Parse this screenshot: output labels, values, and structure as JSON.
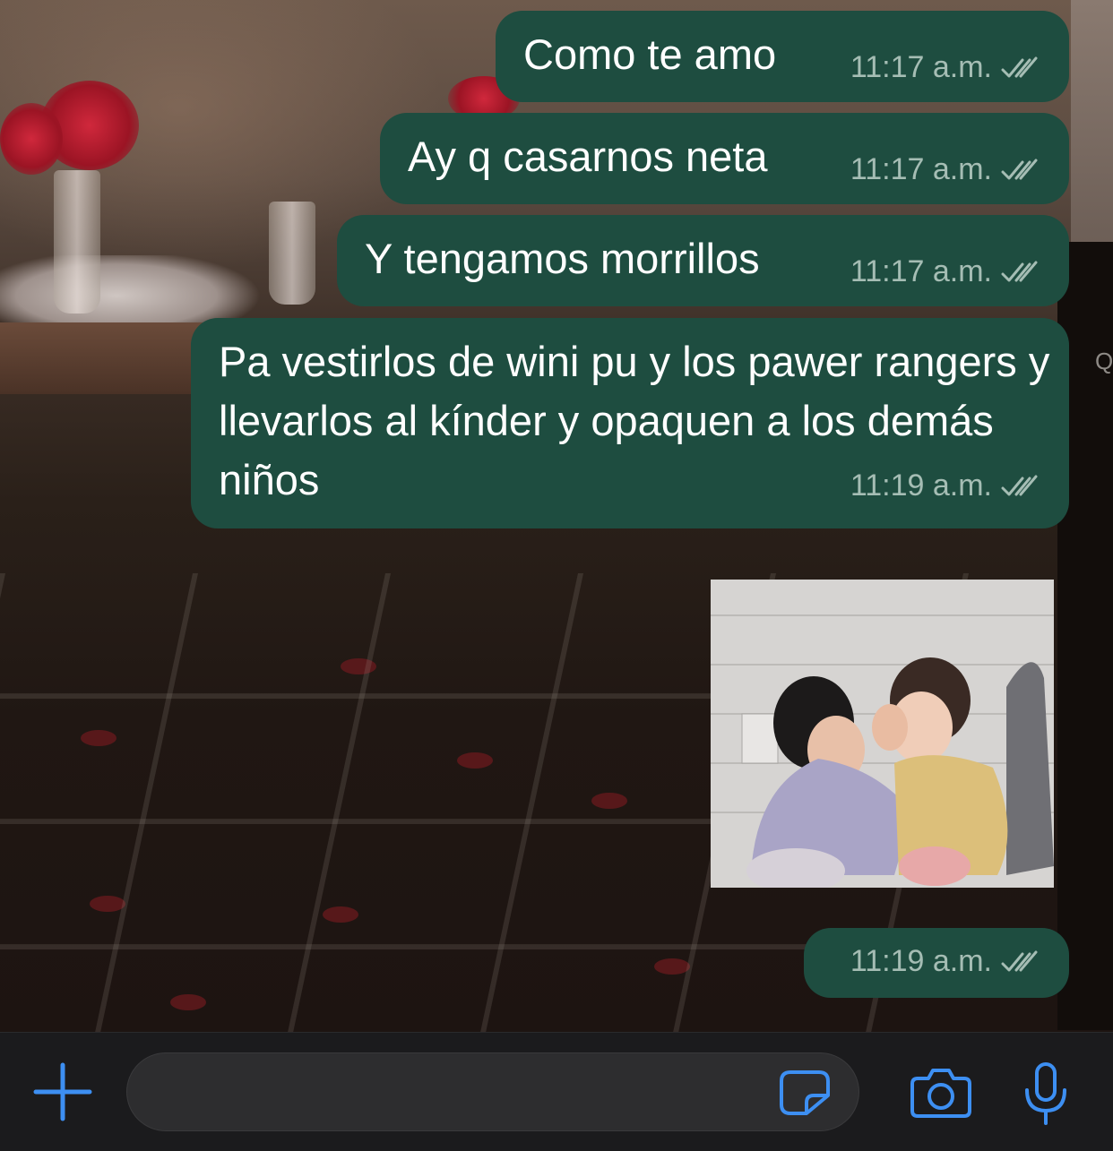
{
  "messages": [
    {
      "text": "Como te amo",
      "time": "11:17 a.m.",
      "status": "read"
    },
    {
      "text": "Ay q casarnos neta",
      "time": "11:17 a.m.",
      "status": "read"
    },
    {
      "text": "Y tengamos morrillos",
      "time": "11:17 a.m.",
      "status": "read"
    },
    {
      "text": "Pa vestirlos de wini pu y los pawer rangers y llevarlos al kínder y opaquen a los demás niños",
      "time": "11:19 a.m.",
      "status": "read"
    },
    {
      "type": "sticker",
      "time": "11:19 a.m.",
      "status": "read"
    }
  ],
  "wallpaper_letter": "Q",
  "composer": {
    "placeholder": "",
    "value": ""
  },
  "icons": {
    "attach": "plus-icon",
    "sticker": "sticker-icon",
    "camera": "camera-icon",
    "mic": "microphone-icon",
    "read_receipt": "double-check-icon"
  },
  "colors": {
    "bubble_out": "#1e4d40",
    "meta_text": "#a5bdb4",
    "accent_blue": "#3d8ff2",
    "input_bar": "#1b1b1d",
    "input_field": "#2d2d2f"
  }
}
